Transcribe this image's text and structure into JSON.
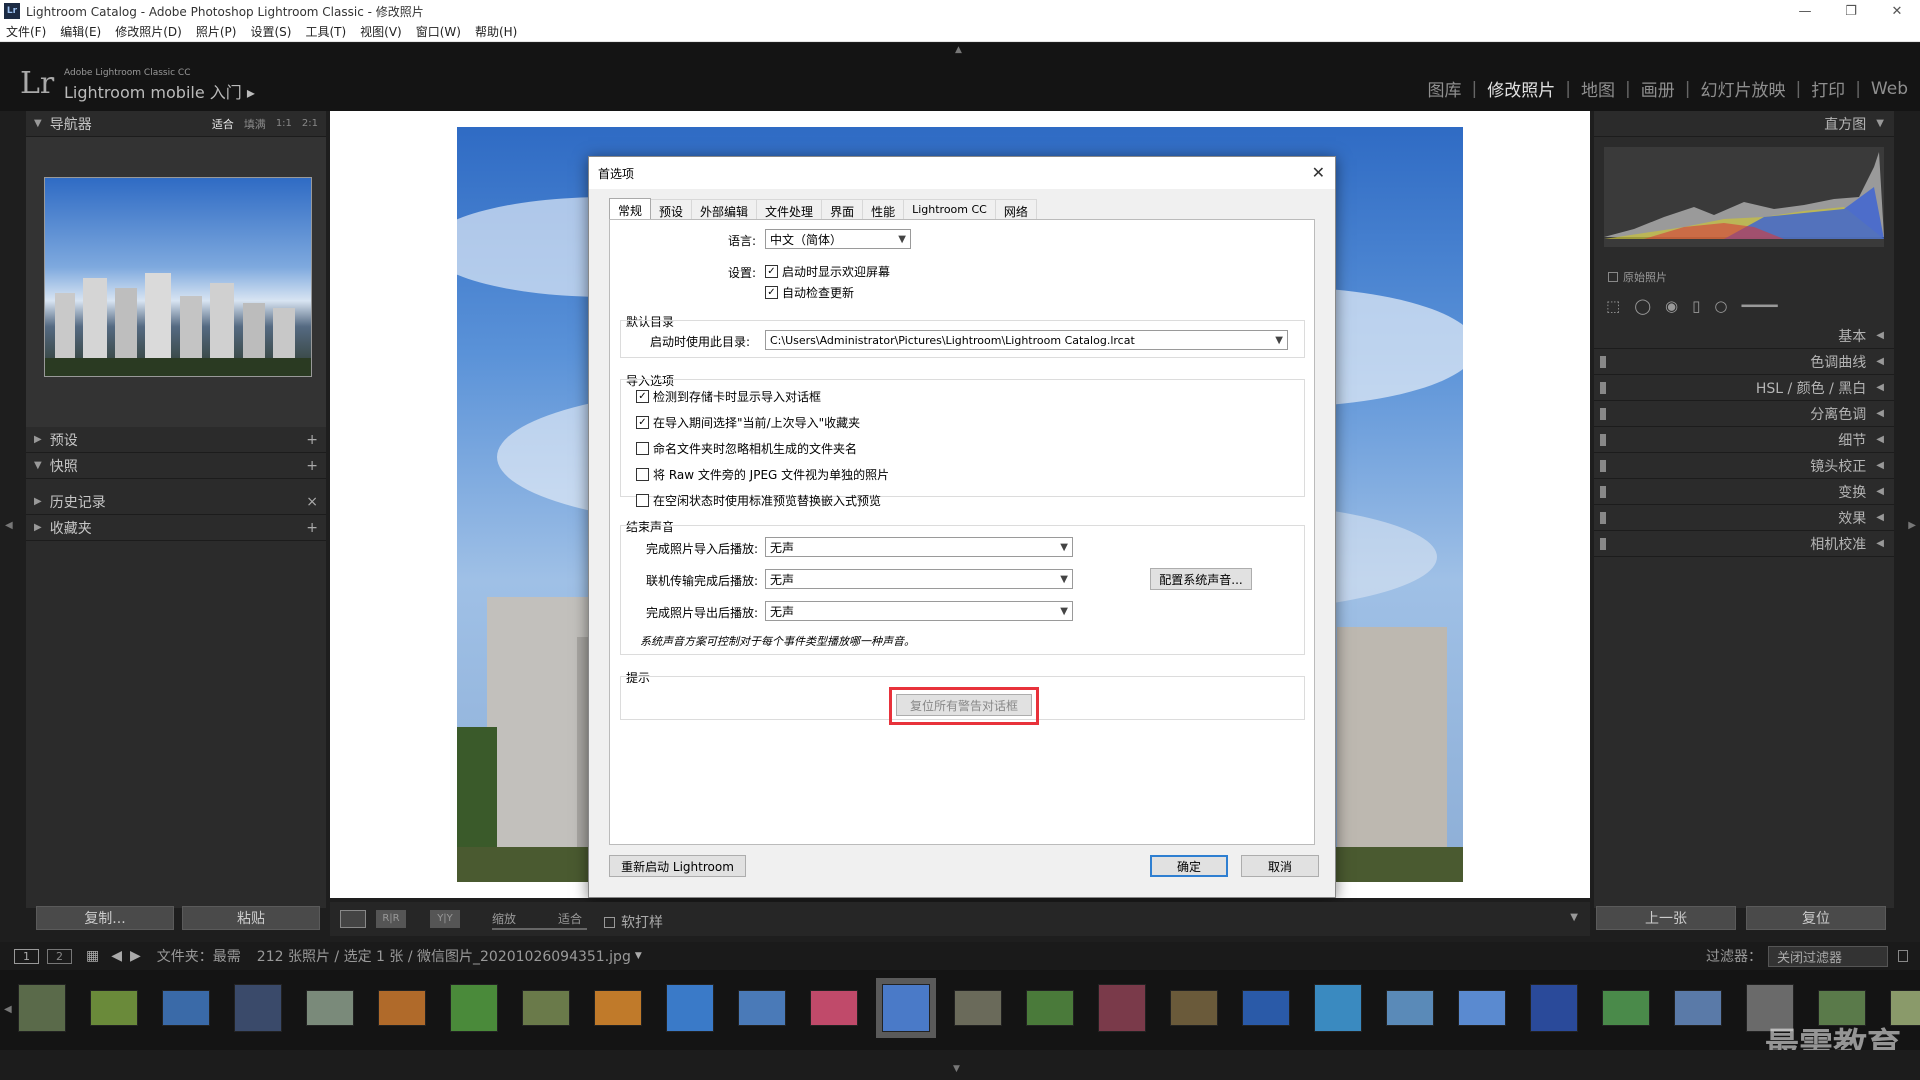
{
  "window": {
    "title": "Lightroom Catalog - Adobe Photoshop Lightroom Classic - 修改照片",
    "logo_text": "Lr"
  },
  "menu": [
    "文件(F)",
    "编辑(E)",
    "修改照片(D)",
    "照片(P)",
    "设置(S)",
    "工具(T)",
    "视图(V)",
    "窗口(W)",
    "帮助(H)"
  ],
  "brand": {
    "logo": "Lr",
    "line1": "Adobe Lightroom Classic CC",
    "line2": "Lightroom mobile 入门 ▸"
  },
  "modules": [
    "图库",
    "修改照片",
    "地图",
    "画册",
    "幻灯片放映",
    "打印",
    "Web"
  ],
  "active_module": "修改照片",
  "left_panel": {
    "navigator": {
      "title": "导航器",
      "zoom": [
        "适合",
        "填满",
        "1:1",
        "2:1"
      ]
    },
    "sections": [
      {
        "name": "预设",
        "action": "+"
      },
      {
        "name": "快照",
        "action": "+"
      },
      {
        "name": "历史记录",
        "action": "×"
      },
      {
        "name": "收藏夹",
        "action": "+"
      }
    ],
    "copy_btn": "复制...",
    "paste_btn": "粘贴"
  },
  "right_panel": {
    "histogram_title": "直方图",
    "original_photo": "原始照片",
    "sections": [
      "基本",
      "色调曲线",
      "HSL / 颜色 / 黑白",
      "分离色调",
      "细节",
      "镜头校正",
      "变换",
      "效果",
      "相机校准"
    ],
    "prev_btn": "上一张",
    "reset_btn": "复位"
  },
  "toolbar": {
    "zoom_label": "缩放",
    "fit_label": "适合",
    "softproof_label": "软打样",
    "view_btns": [
      "R|R",
      "Y|Y"
    ]
  },
  "filmbar": {
    "page_buttons": [
      "1",
      "2"
    ],
    "path": "文件夹：最需",
    "count": "212 张照片 / 选定 1 张 / 微信图片_20201026094351.jpg",
    "filter_label": "过滤器：",
    "filter_value": "关闭过滤器"
  },
  "watermark": "最需教育",
  "dialog": {
    "title": "首选项",
    "tabs": [
      "常规",
      "预设",
      "外部编辑",
      "文件处理",
      "界面",
      "性能",
      "Lightroom CC",
      "网络"
    ],
    "active_tab": "常规",
    "language_label": "语言:",
    "language_value": "中文（简体）",
    "settings_label": "设置:",
    "show_splash": "启动时显示欢迎屏幕",
    "auto_update": "自动检查更新",
    "default_catalog_title": "默认目录",
    "catalog_label": "启动时使用此目录:",
    "catalog_value": "C:\\Users\\Administrator\\Pictures\\Lightroom\\Lightroom Catalog.lrcat",
    "import_title": "导入选项",
    "import_opts": [
      {
        "label": "检测到存储卡时显示导入对话框",
        "checked": true
      },
      {
        "label": "在导入期间选择\"当前/上次导入\"收藏夹",
        "checked": true
      },
      {
        "label": "命名文件夹时忽略相机生成的文件夹名",
        "checked": false
      },
      {
        "label": "将 Raw 文件旁的 JPEG 文件视为单独的照片",
        "checked": false
      },
      {
        "label": "在空闲状态时使用标准预览替换嵌入式预览",
        "checked": false
      }
    ],
    "sound_title": "结束声音",
    "sounds": [
      {
        "label": "完成照片导入后播放:",
        "value": "无声"
      },
      {
        "label": "联机传输完成后播放:",
        "value": "无声"
      },
      {
        "label": "完成照片导出后播放:",
        "value": "无声"
      }
    ],
    "config_sound_btn": "配置系统声音...",
    "sound_note": "系统声音方案可控制对于每个事件类型播放哪一种声音。",
    "tips_title": "提示",
    "reset_warnings_btn": "复位所有警告对话框",
    "restart_btn": "重新启动 Lightroom",
    "ok_btn": "确定",
    "cancel_btn": "取消"
  }
}
